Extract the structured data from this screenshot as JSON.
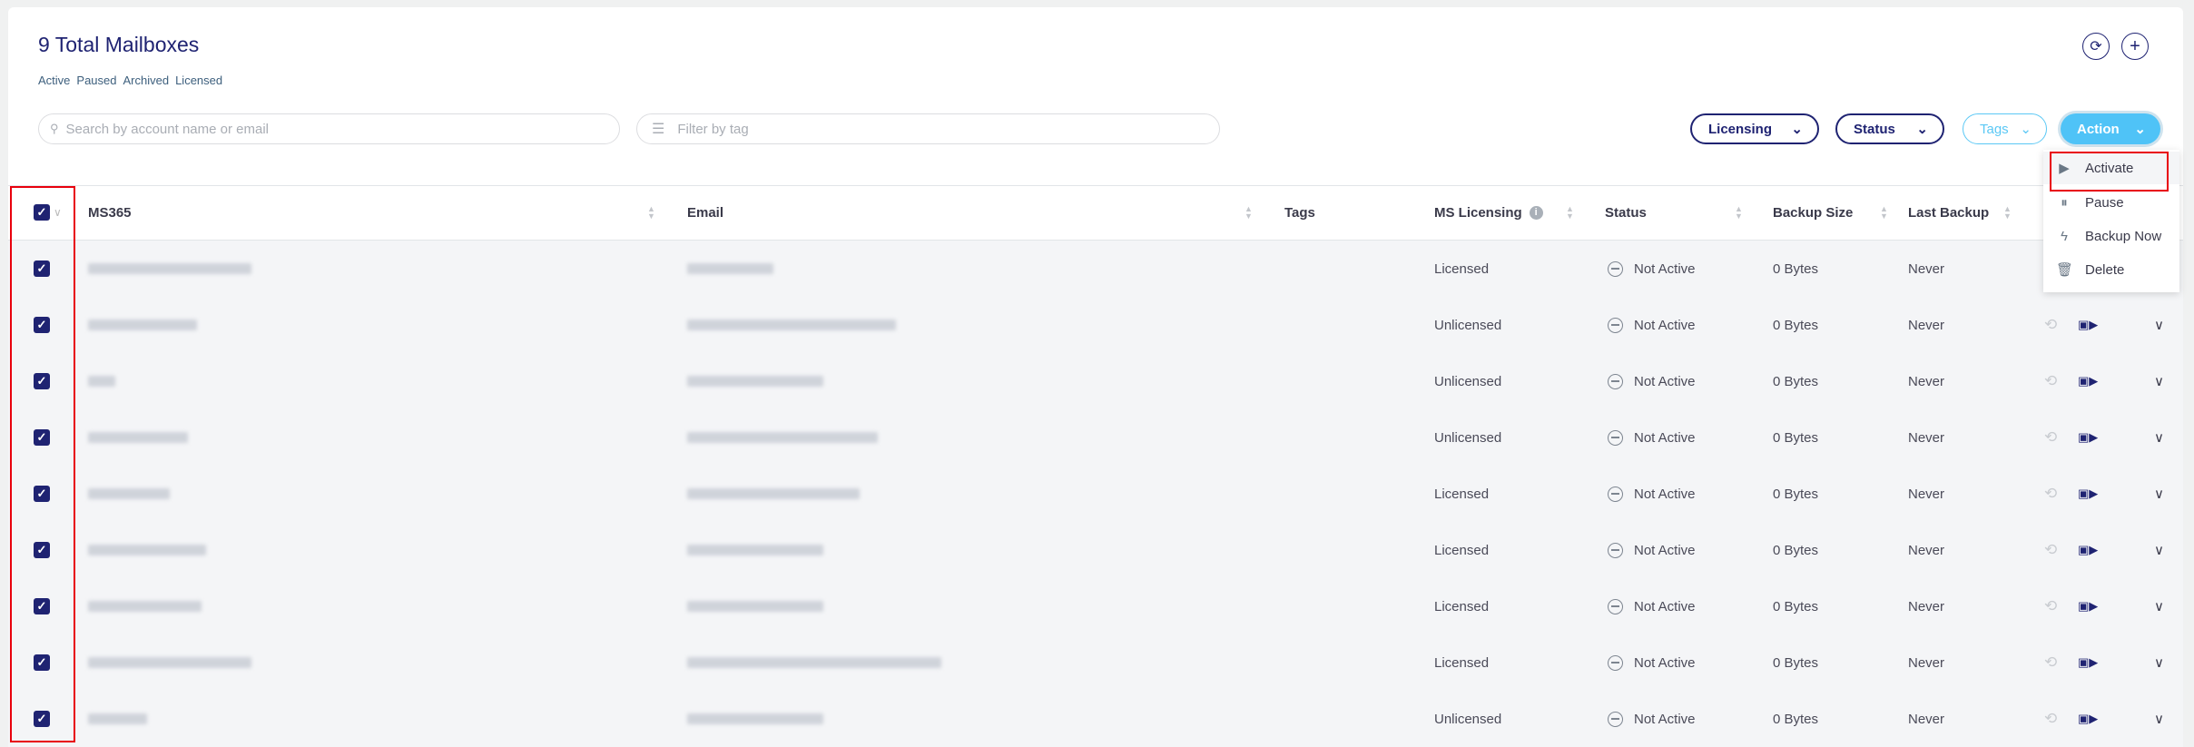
{
  "header": {
    "title": "9 Total Mailboxes",
    "filters": [
      "Active",
      "Paused",
      "Archived",
      "Licensed"
    ]
  },
  "search": {
    "placeholder": "Search by account name or email"
  },
  "tag_filter": {
    "placeholder": "Filter by tag"
  },
  "buttons": {
    "licensing": "Licensing",
    "status": "Status",
    "tags": "Tags",
    "action": "Action"
  },
  "action_menu": [
    {
      "label": "Activate",
      "icon": "calendar-play-icon"
    },
    {
      "label": "Pause",
      "icon": "calendar-pause-icon"
    },
    {
      "label": "Backup Now",
      "icon": "lightning-icon"
    },
    {
      "label": "Delete",
      "icon": "trash-icon"
    }
  ],
  "columns": {
    "ms365": "MS365",
    "email": "Email",
    "tags": "Tags",
    "licensing": "MS Licensing",
    "status": "Status",
    "backup_size": "Backup Size",
    "last_backup": "Last Backup"
  },
  "rows": [
    {
      "licensing": "Licensed",
      "status": "Not Active",
      "size": "0 Bytes",
      "last": "Never"
    },
    {
      "licensing": "Unlicensed",
      "status": "Not Active",
      "size": "0 Bytes",
      "last": "Never"
    },
    {
      "licensing": "Unlicensed",
      "status": "Not Active",
      "size": "0 Bytes",
      "last": "Never"
    },
    {
      "licensing": "Unlicensed",
      "status": "Not Active",
      "size": "0 Bytes",
      "last": "Never"
    },
    {
      "licensing": "Licensed",
      "status": "Not Active",
      "size": "0 Bytes",
      "last": "Never"
    },
    {
      "licensing": "Licensed",
      "status": "Not Active",
      "size": "0 Bytes",
      "last": "Never"
    },
    {
      "licensing": "Licensed",
      "status": "Not Active",
      "size": "0 Bytes",
      "last": "Never"
    },
    {
      "licensing": "Licensed",
      "status": "Not Active",
      "size": "0 Bytes",
      "last": "Never"
    },
    {
      "licensing": "Unlicensed",
      "status": "Not Active",
      "size": "0 Bytes",
      "last": "Never"
    }
  ],
  "colors": {
    "primary": "#1f2372",
    "accent": "#4fc3f7",
    "highlight": "#e8000d"
  }
}
